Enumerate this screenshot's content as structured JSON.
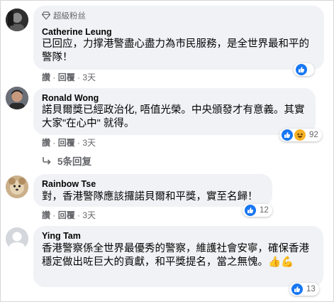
{
  "comments": [
    {
      "badge": "超級粉丝",
      "author": "Catherine Leung",
      "text": "已回应，力撑港警盡心盡力為市民服務，是全世界最和平的警隊！",
      "actions": {
        "like": "讚",
        "reply": "回覆",
        "time": "3天"
      },
      "reactions": {
        "types": [
          "like"
        ],
        "count": ""
      }
    },
    {
      "author": "Ronald Wong",
      "text": "諾貝爾獎已經政治化, 唔值光榮。中央頒發才有意義。其實大家\"在心中\" 就得。",
      "actions": {
        "like": "讚",
        "reply": "回覆",
        "time": "3天"
      },
      "reactions": {
        "types": [
          "like",
          "haha"
        ],
        "count": "92"
      },
      "replies_label": "5条回复"
    },
    {
      "author": "Rainbow Tse",
      "text": "對，香港警隊應該攞諾貝爾和平獎，實至名歸！",
      "actions": {
        "like": "讚",
        "reply": "回覆",
        "time": "3天"
      },
      "reactions": {
        "types": [
          "like"
        ],
        "count": "12"
      }
    },
    {
      "author": "Ying Tam",
      "text": "香港警察係全世界最優秀的警察，維護社會安寧，確保香港穩定做出咗巨大的貢獻，和平獎提名，當之無愧。👍💪",
      "actions": {
        "like": "讚",
        "reply": "回覆",
        "time": "3天"
      },
      "reactions": {
        "types": [
          "like"
        ],
        "count": "13"
      }
    }
  ],
  "icons": {
    "badge": "diamond-icon",
    "replies": "reply-arrow-icon",
    "like_reaction": "like-reaction-icon",
    "haha_reaction": "haha-reaction-icon"
  },
  "colors": {
    "bubble": "#f0f2f5",
    "like_blue": "#1877f2",
    "haha_yellow": "#f7b125",
    "meta_gray": "#65676b"
  }
}
